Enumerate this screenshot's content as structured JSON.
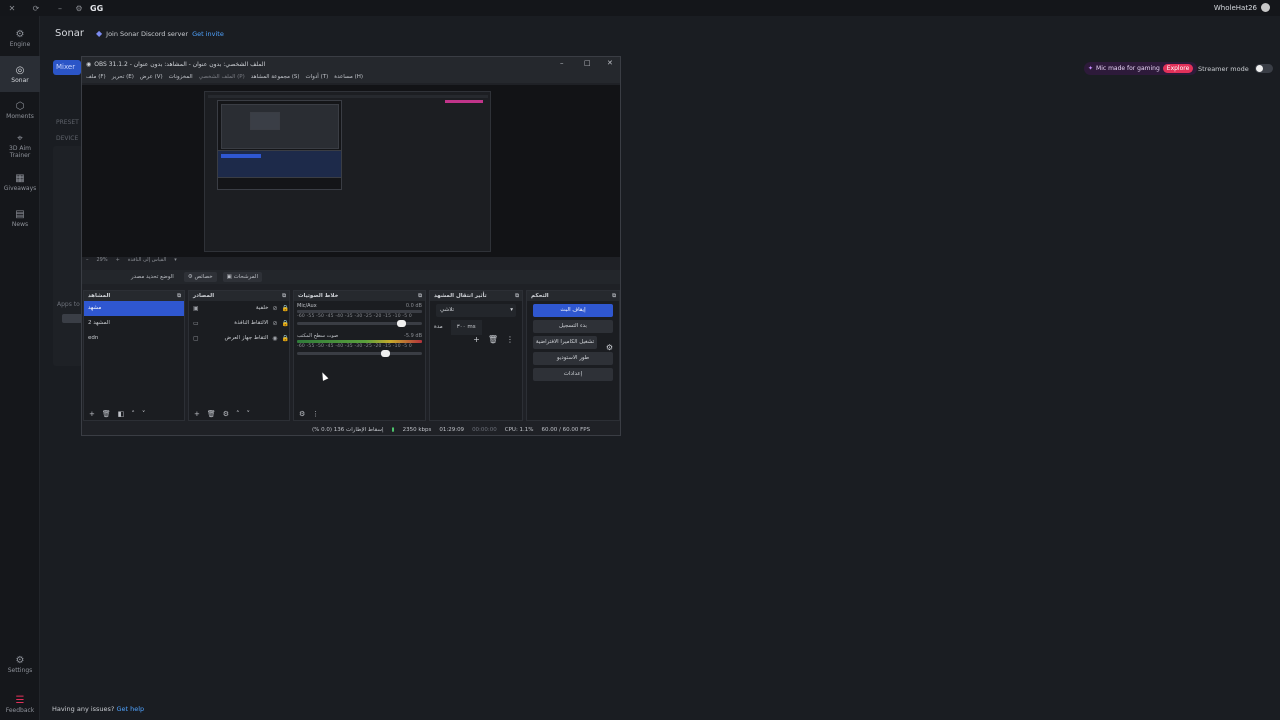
{
  "app": {
    "title": "GG",
    "user": "WholeHat26"
  },
  "rail": {
    "items": [
      {
        "label": "Engine",
        "icon": "engine-icon"
      },
      {
        "label": "Sonar",
        "icon": "sonar-icon"
      },
      {
        "label": "Moments",
        "icon": "moments-icon"
      },
      {
        "label": "3D Aim Trainer",
        "icon": "aim-icon"
      },
      {
        "label": "Giveaways",
        "icon": "giveaways-icon"
      },
      {
        "label": "News",
        "icon": "news-icon"
      }
    ],
    "bottom": [
      {
        "label": "Settings",
        "icon": "gear-icon"
      },
      {
        "label": "Feedback",
        "icon": "feedback-icon"
      }
    ]
  },
  "main": {
    "title": "Sonar",
    "discord_text": "Join Sonar Discord server",
    "discord_link": "Get invite",
    "mixer_tab": "Mixer",
    "presets": "PRESET",
    "device": "DEVICE",
    "apps": "Apps to",
    "mic_text": "Mic made for gaming",
    "explore": "Explore",
    "streamer_mode": "Streamer mode",
    "help_text": "Having any issues?",
    "help_link": "Get help"
  },
  "obs": {
    "title": "OBS 31.1.2 - الملف الشخصي: بدون عنوان - المشاهد: بدون عنوان",
    "menu": [
      "ملف (F)",
      "تحرير (E)",
      "عرض (V)",
      "المخزونات",
      "الملف الشخصي (P)",
      "مجموعة المشاهد (S)",
      "أدوات (T)",
      "مساعدة (H)"
    ],
    "zoom": "29%",
    "zoom_label": "القياس إلى النافذة",
    "tabs": [
      "الوضع تحديد مصدر",
      "خصائص",
      "المرشحات"
    ],
    "scenes_header": "المشاهد",
    "scenes": [
      "مشهد",
      "المشهد 2",
      "edn"
    ],
    "sources_header": "المصادر",
    "sources": [
      "خلفية",
      "الالتقاط النافذة",
      "التقاط جهاز العرض"
    ],
    "mixer_header": "خلاط الصوتيات",
    "tracks": [
      {
        "name": "Mic/Aux",
        "db": "0.0 dB"
      },
      {
        "name": "صوت سطح المكتب",
        "db": "-5.9 dB"
      }
    ],
    "scale": "-60 -55 -50 -45 -40 -35 -30 -25 -20 -15 -10 -5 0",
    "transitions_header": "تأثير انتقال المشهد",
    "transition": "تلاشي",
    "duration_label": "مدة",
    "duration": "٣٠٠ ms",
    "controls_header": "التحكم",
    "controls": [
      "إيقاف البث",
      "بدء التسجيل",
      "تشغيل الكاميرا الافتراضية",
      "طور الاستوديو",
      "إعدادات"
    ],
    "status": {
      "dropped": "إسقاط الإطارات 136 (0.0 %)",
      "bitrate": "2350 kbps",
      "live": "01:29:09",
      "rec": "00:00:00",
      "cpu": "CPU: 1.1%",
      "fps": "60.00 / 60.00 FPS"
    }
  },
  "colors": {
    "accent": "#2f57d0",
    "explore": "#e2315a",
    "link": "#4fa3ff"
  }
}
